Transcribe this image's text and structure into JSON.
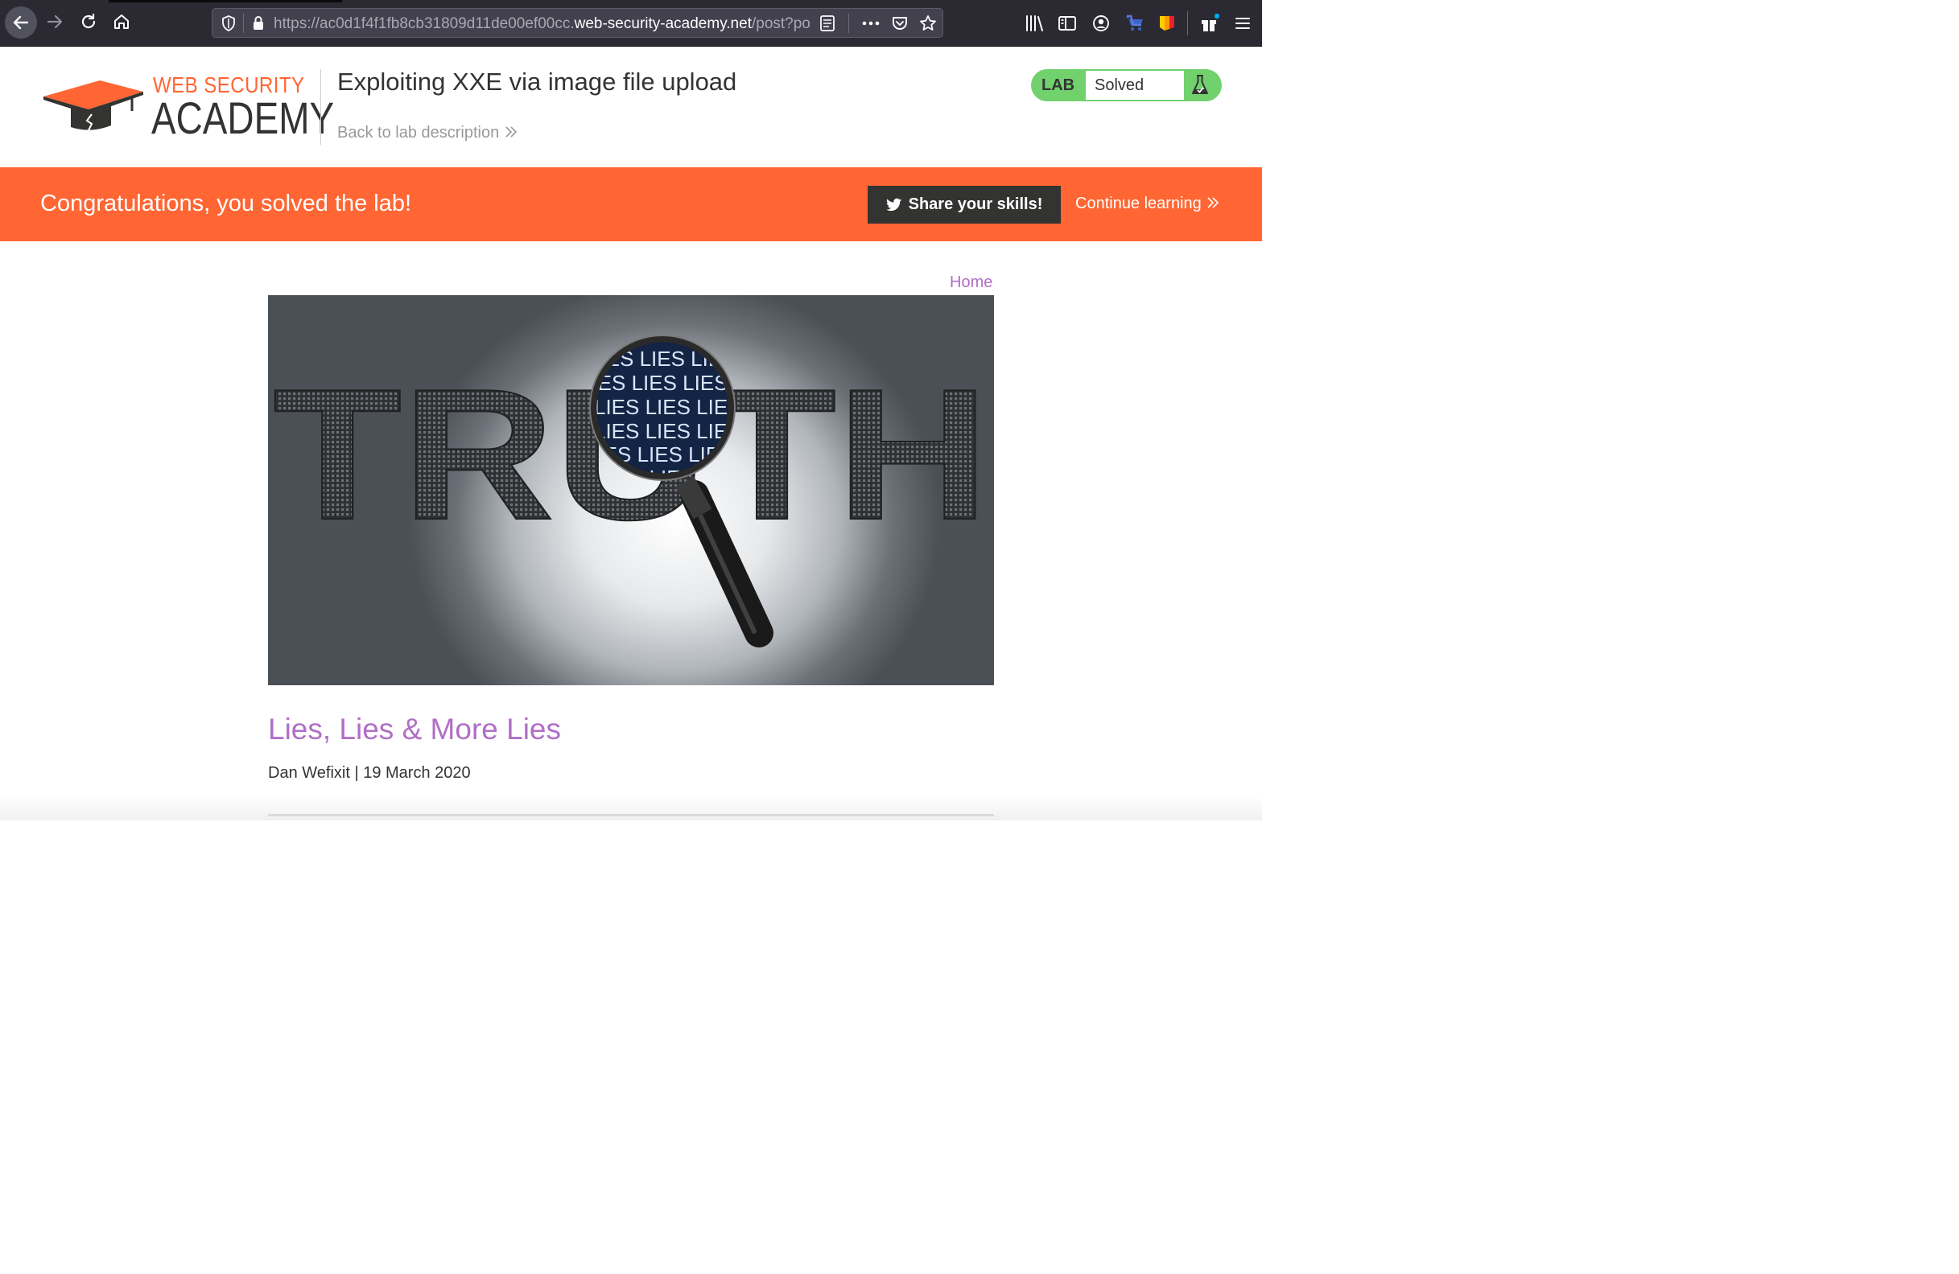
{
  "browser": {
    "url_prefix": "https://ac0d1f4f1fb8cb31809d11de00ef00cc.",
    "url_host": "web-security-academy.net",
    "url_suffix": "/post?pos"
  },
  "header": {
    "logo_top": "WEB SECURITY",
    "logo_bottom": "ACADEMY",
    "lab_title": "Exploiting XXE via image file upload",
    "back_link": "Back to lab description",
    "lab_badge": "LAB",
    "lab_status": "Solved"
  },
  "banner": {
    "message": "Congratulations, you solved the lab!",
    "share_label": "Share your skills!",
    "continue_label": "Continue learning"
  },
  "post": {
    "home_link": "Home",
    "image_word": "TRUTH",
    "image_lens_text": "LIES LIES LIES LIES",
    "title": "Lies, Lies & More Lies",
    "meta": "Dan Wefixit | 19 March 2020"
  },
  "colors": {
    "accent_orange": "#ff6633",
    "status_green": "#70d16d",
    "link_purple": "#b06fc6",
    "dark_text": "#333332"
  }
}
